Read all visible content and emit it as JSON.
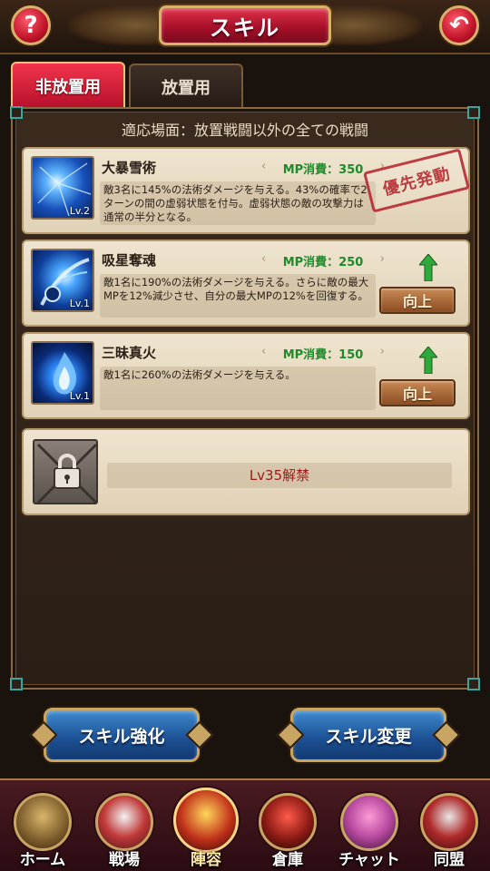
{
  "header": {
    "title": "スキル",
    "help_glyph": "?",
    "back_glyph": "↶"
  },
  "tabs": [
    {
      "label": "非放置用",
      "active": true
    },
    {
      "label": "放置用",
      "active": false
    }
  ],
  "scene_text": "適応場面：放置戦闘以外の全ての戦闘",
  "skills": [
    {
      "name": "大暴雪術",
      "mp": "MP消費：350",
      "level": "Lv.2",
      "description": "敵3名に145%の法術ダメージを与える。43%の確率で2ターンの間の虚弱状態を付与。虚弱状態の敵の攻撃力は通常の半分となる。",
      "stamp": "優先発動",
      "icon": "blizzard-icon"
    },
    {
      "name": "吸星奪魂",
      "mp": "MP消費：250",
      "level": "Lv.1",
      "description": "敵1名に190%の法術ダメージを与える。さらに敵の最大MPを12%減少させ、自分の最大MPの12%を回復する。",
      "upgrade_label": "向上",
      "icon": "soul-drain-icon"
    },
    {
      "name": "三昧真火",
      "mp": "MP消費：150",
      "level": "Lv.1",
      "description": "敵1名に260%の法術ダメージを与える。",
      "upgrade_label": "向上",
      "icon": "blue-flame-icon"
    }
  ],
  "locked_skill": {
    "unlock_text": "Lv35解禁",
    "icon": "chained-lock-icon"
  },
  "actions": {
    "enhance_label": "スキル強化",
    "change_label": "スキル変更"
  },
  "nav": [
    {
      "label": "ホーム",
      "icon": "home-castle-icon"
    },
    {
      "label": "戦場",
      "icon": "battlefield-icon"
    },
    {
      "label": "陣容",
      "icon": "samurai-helmet-icon",
      "active": true
    },
    {
      "label": "倉庫",
      "icon": "warehouse-icon"
    },
    {
      "label": "チャット",
      "icon": "fan-chat-icon"
    },
    {
      "label": "同盟",
      "icon": "alliance-icon"
    }
  ],
  "colors": {
    "accent_red": "#c0142a",
    "gold_border": "#c8a562",
    "mp_green": "#1e8a2a",
    "unlock_red": "#9a1a1a",
    "button_blue": "#1c4f92"
  }
}
